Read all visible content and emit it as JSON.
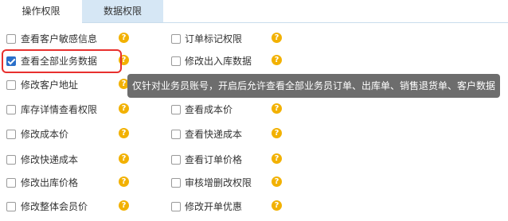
{
  "tabs": [
    {
      "label": "操作权限",
      "active": true
    },
    {
      "label": "数据权限",
      "active": false
    }
  ],
  "permissions": {
    "left": [
      {
        "label": "查看客户敏感信息",
        "checked": false,
        "help": "?"
      },
      {
        "label": "查看全部业务数据",
        "checked": true,
        "help": "?"
      },
      {
        "label": "修改客户地址",
        "checked": false,
        "help": "?"
      },
      {
        "label": "库存详情查看权限",
        "checked": false,
        "help": "?"
      },
      {
        "label": "修改成本价",
        "checked": false,
        "help": "?"
      },
      {
        "label": "修改快递成本",
        "checked": false,
        "help": "?"
      },
      {
        "label": "修改出库价格",
        "checked": false,
        "help": "?"
      },
      {
        "label": "修改整体会员价",
        "checked": false,
        "help": "?"
      }
    ],
    "right": [
      {
        "label": "订单标记权限",
        "checked": false,
        "help": "?"
      },
      {
        "label": "修改出入库数据",
        "checked": false,
        "help": "?"
      },
      {
        "label": "",
        "checked": false,
        "help": ""
      },
      {
        "label": "查看成本价",
        "checked": false,
        "help": "?"
      },
      {
        "label": "查看快递成本",
        "checked": false,
        "help": "?"
      },
      {
        "label": "查看订单价格",
        "checked": false,
        "help": "?"
      },
      {
        "label": "审核增删改权限",
        "checked": false,
        "help": "?"
      },
      {
        "label": "修改开单优惠",
        "checked": false,
        "help": "?"
      }
    ]
  },
  "tooltip": {
    "text": "仅针对业务员账号，开启后允许查看全部业务员订单、出库单、销售退货单、客户数据"
  },
  "colors": {
    "checkbox_checked": "#2a6fc9",
    "highlight_border": "#e8302e",
    "help_icon": "#f2b100",
    "tab_inactive_bg": "#d6e7f5",
    "tooltip_bg": "#6d6d6d"
  }
}
